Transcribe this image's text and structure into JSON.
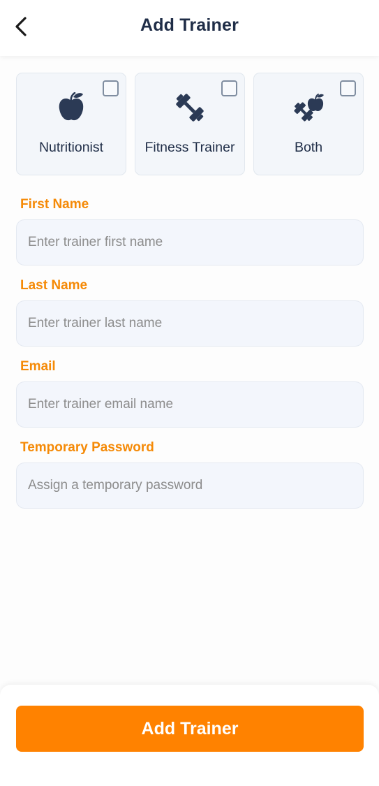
{
  "header": {
    "title": "Add Trainer",
    "back_icon": "chevron-left-icon"
  },
  "roles": [
    {
      "label": "Nutritionist",
      "icon": "apple-icon",
      "checked": false
    },
    {
      "label": "Fitness Trainer",
      "icon": "dumbbell-icon",
      "checked": false
    },
    {
      "label": "Both",
      "icon": "dumbbell-apple-icon",
      "checked": false
    }
  ],
  "form": {
    "first_name": {
      "label": "First Name",
      "placeholder": "Enter trainer first name"
    },
    "last_name": {
      "label": "Last Name",
      "placeholder": "Enter trainer last name"
    },
    "email": {
      "label": "Email",
      "placeholder": "Enter trainer email name"
    },
    "password": {
      "label": "Temporary Password",
      "placeholder": "Assign a temporary password"
    }
  },
  "footer": {
    "submit_label": "Add Trainer"
  },
  "colors": {
    "accent": "#ff8200",
    "label_orange": "#f58a07",
    "heading": "#1f2d47",
    "icon": "#2b3a55"
  }
}
